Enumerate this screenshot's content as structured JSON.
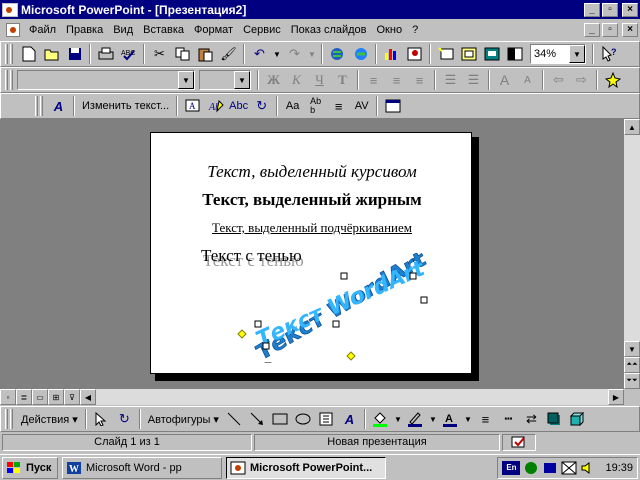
{
  "window": {
    "title": "Microsoft PowerPoint - [Презентация2]",
    "min": "_",
    "restore": "▫",
    "close": "×"
  },
  "menu": {
    "items": [
      "Файл",
      "Правка",
      "Вид",
      "Вставка",
      "Формат",
      "Сервис",
      "Показ слайдов",
      "Окно",
      "?"
    ],
    "accel": [
      "Ф",
      "П",
      "В",
      "а",
      "о",
      "С",
      "П",
      "О",
      "?"
    ]
  },
  "standard_toolbar": {
    "zoom": "34%"
  },
  "formatting_toolbar": {
    "font": "",
    "size": ""
  },
  "wordart_toolbar": {
    "edit_text": "Изменить текст..."
  },
  "slide": {
    "italic_text": "Текст, выделенный курсивом",
    "bold_text": "Текст, выделенный жирным",
    "underline_text": "Текст, выделенный подчёркиванием",
    "shadow_text": "Текст с тенью",
    "wordart_text": "Текст WordArt"
  },
  "drawing_toolbar": {
    "actions": "Действия",
    "autoshapes": "Автофигуры"
  },
  "status": {
    "slide": "Слайд 1 из 1",
    "template": "Новая презентация"
  },
  "taskbar": {
    "start": "Пуск",
    "tasks": [
      "Microsoft Word - pp",
      "Microsoft PowerPoint..."
    ],
    "lang": "En",
    "time": "19:39"
  },
  "colors": {
    "titlebar": "#000080",
    "wordart_fill": "#33b5ff",
    "handle": "#ffff00"
  }
}
